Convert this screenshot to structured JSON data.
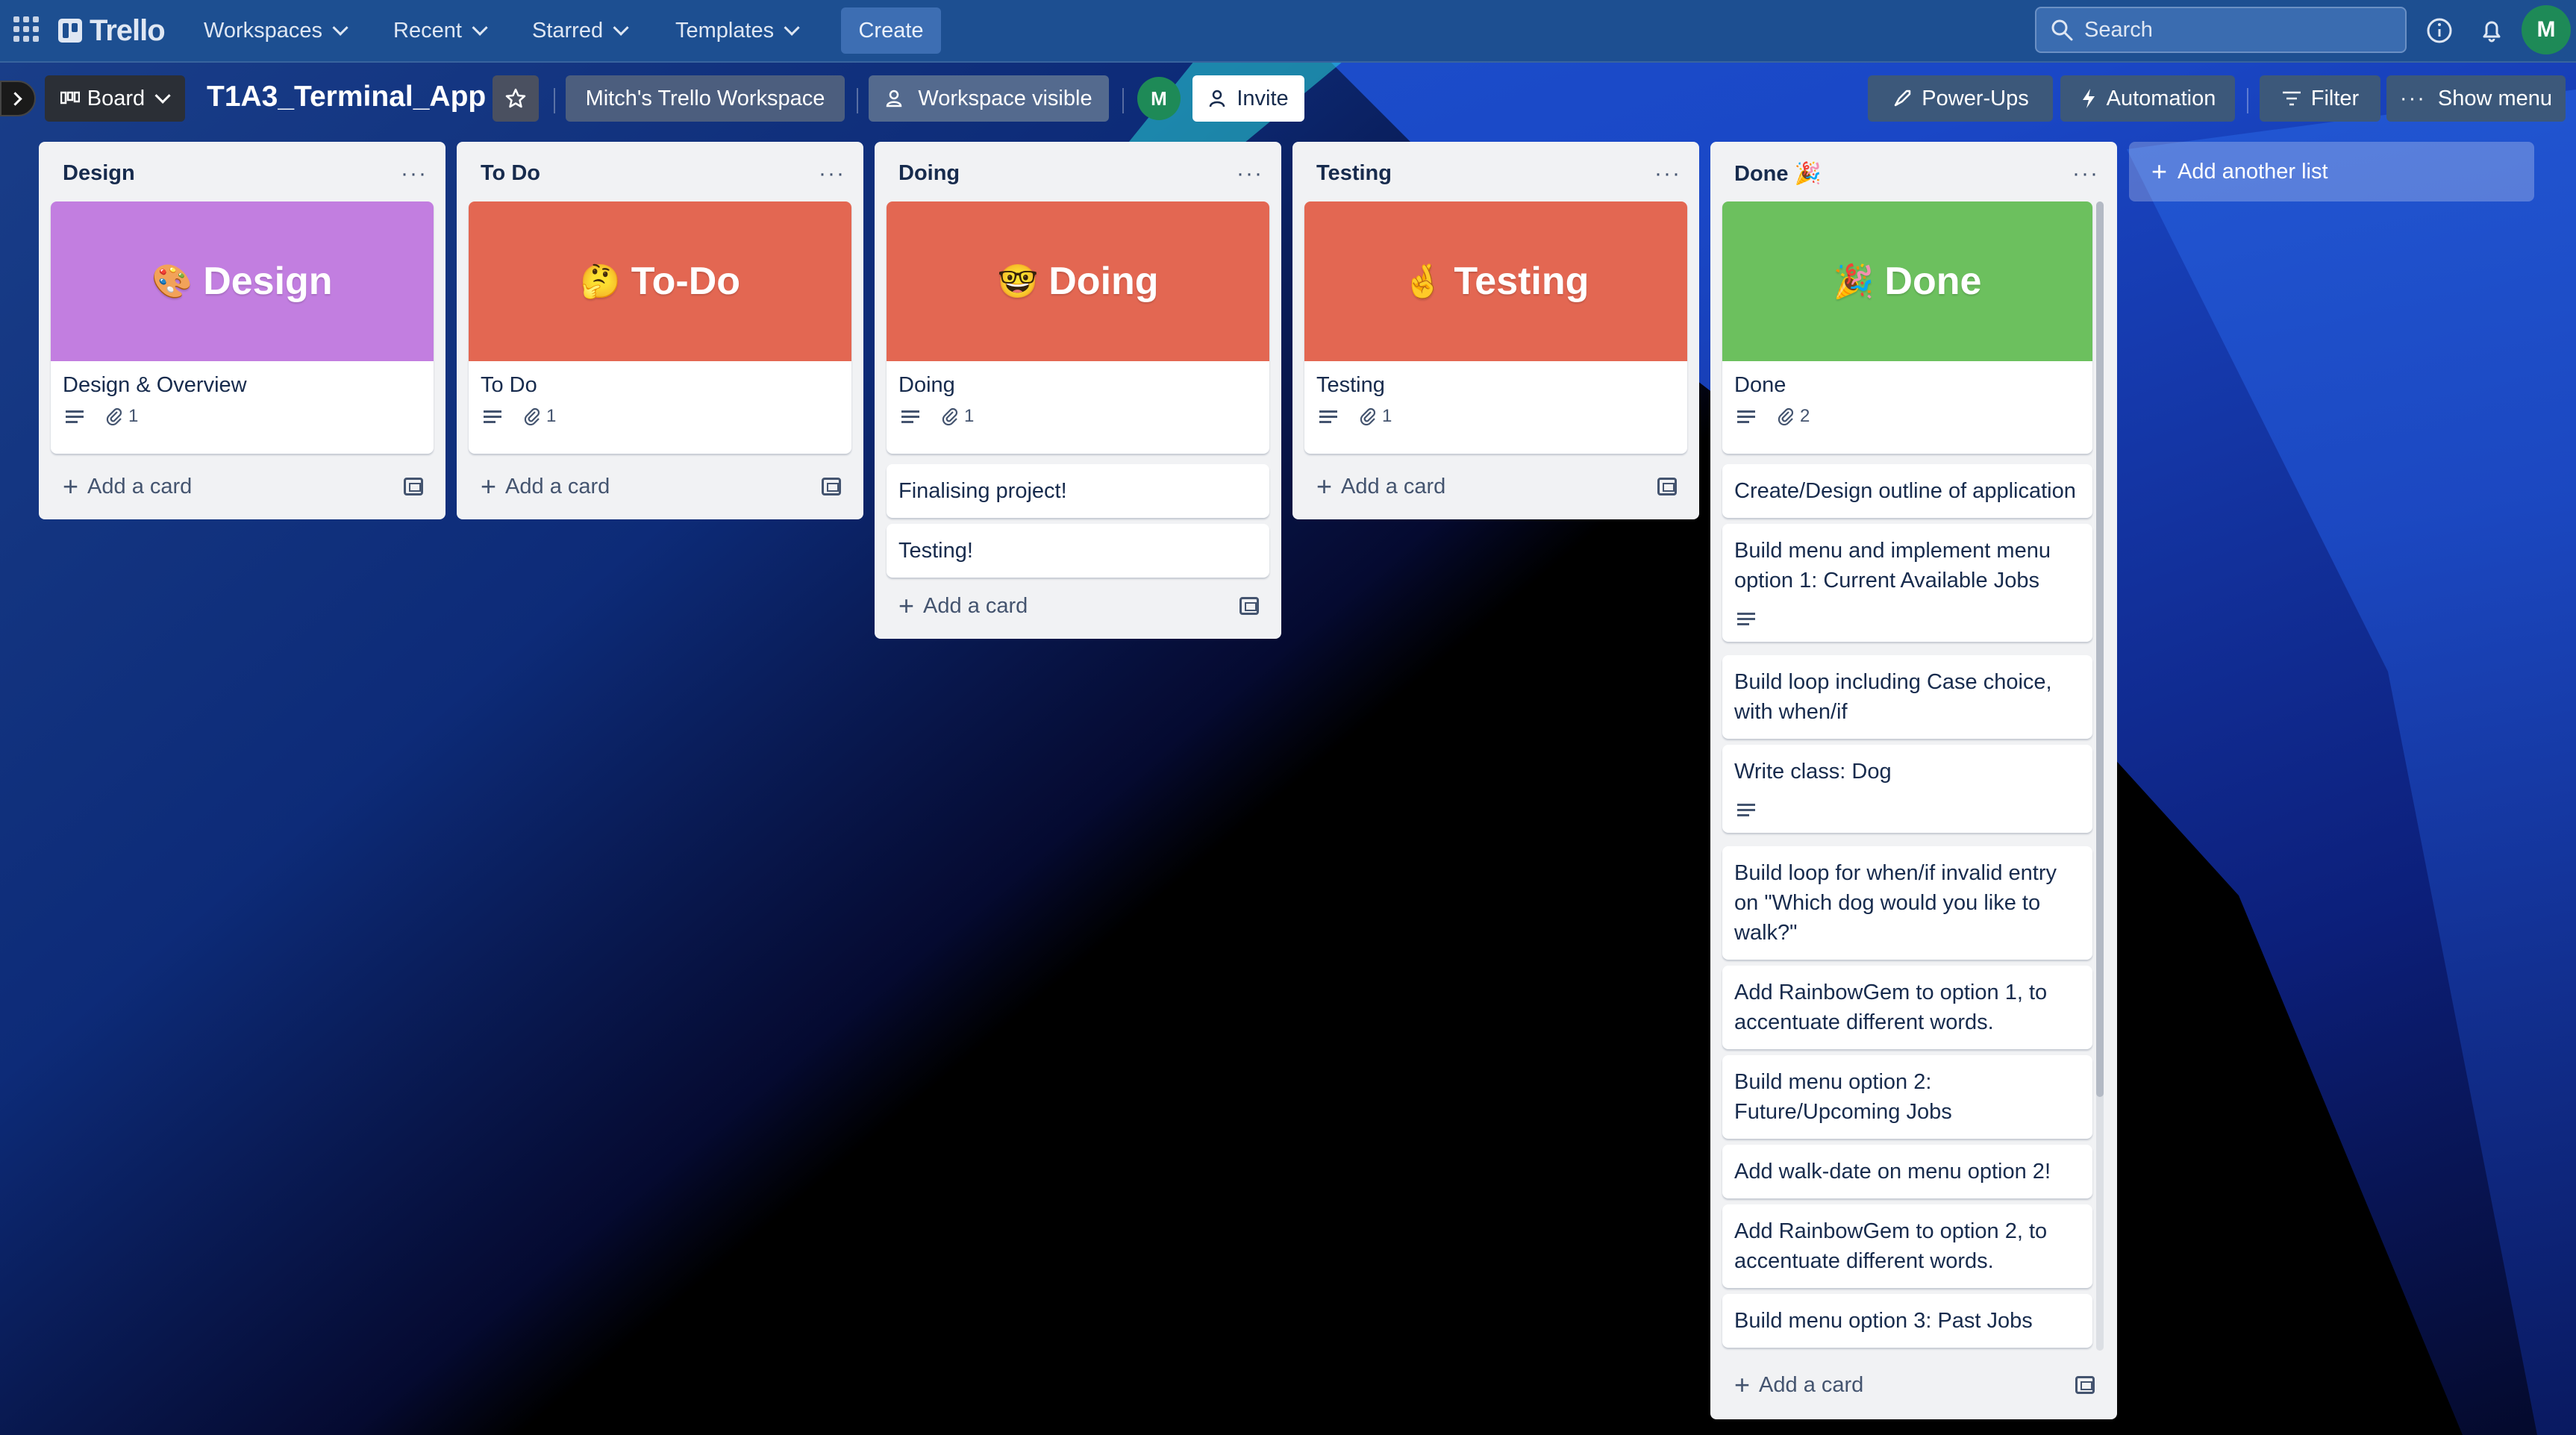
{
  "nav": {
    "logo": "Trello",
    "workspaces": "Workspaces",
    "recent": "Recent",
    "starred": "Starred",
    "templates": "Templates",
    "create": "Create",
    "search_placeholder": "Search",
    "avatar": "M",
    "icons": [
      "apps-grid-icon",
      "info-icon",
      "bell-icon"
    ]
  },
  "board": {
    "view": "Board",
    "title": "T1A3_Terminal_App",
    "workspace": "Mitch's Trello Workspace",
    "visibility": "Workspace visible",
    "member": "M",
    "invite": "Invite",
    "powerups": "Power-Ups",
    "automation": "Automation",
    "filter": "Filter",
    "show_menu": "Show menu",
    "add_list": "Add another list"
  },
  "lists": [
    {
      "title": "Design",
      "cover_label": "Design",
      "cover_emoji": "🎨",
      "cover_color": "#c27ee0",
      "card_name": "Design & Overview",
      "attachments": "1",
      "add_card": "Add a card"
    },
    {
      "title": "To Do",
      "cover_label": "To-Do",
      "cover_emoji": "🤔",
      "cover_color": "#e36752",
      "card_name": "To Do",
      "attachments": "1",
      "add_card": "Add a card"
    },
    {
      "title": "Doing",
      "cover_label": "Doing",
      "cover_emoji": "🤓",
      "cover_color": "#e36752",
      "card_name": "Doing",
      "attachments": "1",
      "cards": [
        "Finalising project!",
        "Testing!"
      ],
      "add_card": "Add a card"
    },
    {
      "title": "Testing",
      "cover_label": "Testing",
      "cover_emoji": "🤞",
      "cover_color": "#e36752",
      "card_name": "Testing",
      "attachments": "1",
      "add_card": "Add a card"
    },
    {
      "title": "Done 🎉",
      "cover_label": "Done",
      "cover_emoji": "🎉",
      "cover_color": "#6cc05e",
      "card_name": "Done",
      "attachments": "2",
      "cards": [
        "Create/Design outline of application",
        "Build menu and implement menu option 1: Current Available Jobs",
        "Build loop including Case choice, with when/if",
        "Write class: Dog",
        "Build loop for when/if invalid entry on \"Which dog would you like to walk?\"",
        "Add RainbowGem to option 1, to accentuate different words.",
        "Build menu option 2: Future/Upcoming Jobs",
        "Add walk-date on menu option 2!",
        "Add RainbowGem to option 2, to accentuate different words.",
        "Build menu option 3: Past Jobs"
      ],
      "add_card": "Add a card"
    }
  ]
}
